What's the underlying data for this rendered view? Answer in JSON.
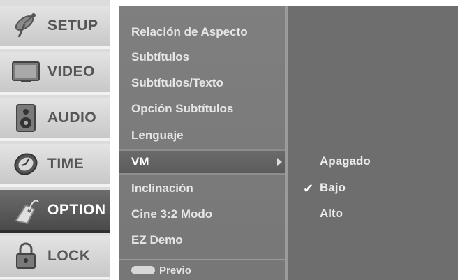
{
  "sidebar": {
    "items": [
      {
        "label": "SETUP",
        "icon": "satellite-dish-icon",
        "active": false
      },
      {
        "label": "VIDEO",
        "icon": "monitor-icon",
        "active": false
      },
      {
        "label": "AUDIO",
        "icon": "speaker-icon",
        "active": false
      },
      {
        "label": "TIME",
        "icon": "clock-icon",
        "active": false
      },
      {
        "label": "OPTION",
        "icon": "tag-icon",
        "active": true
      },
      {
        "label": "LOCK",
        "icon": "padlock-icon",
        "active": false
      }
    ]
  },
  "menu": {
    "items": [
      {
        "label": "Relación de Aspecto"
      },
      {
        "label": "Subtítulos"
      },
      {
        "label": "Subtítulos/Texto"
      },
      {
        "label": "Opción Subtítulos"
      },
      {
        "label": "Lenguaje"
      },
      {
        "label": "VM",
        "selected": true,
        "has_submenu": true
      },
      {
        "label": "Inclinación"
      },
      {
        "label": "Cine 3:2 Modo"
      },
      {
        "label": "EZ Demo"
      }
    ],
    "footer": {
      "label": "Previo",
      "key_icon": "menu-key-icon"
    }
  },
  "submenu": {
    "items": [
      {
        "label": "Apagado",
        "checked": false
      },
      {
        "label": "Bajo",
        "checked": true
      },
      {
        "label": "Alto",
        "checked": false
      }
    ]
  },
  "colors": {
    "sidebar_bg": "#dcdcdc",
    "active_bg": "#4a4a4a",
    "menu_bg": "#7f7f7f",
    "submenu_bg": "#6e6e6e",
    "text_light": "#e6e6e6"
  }
}
